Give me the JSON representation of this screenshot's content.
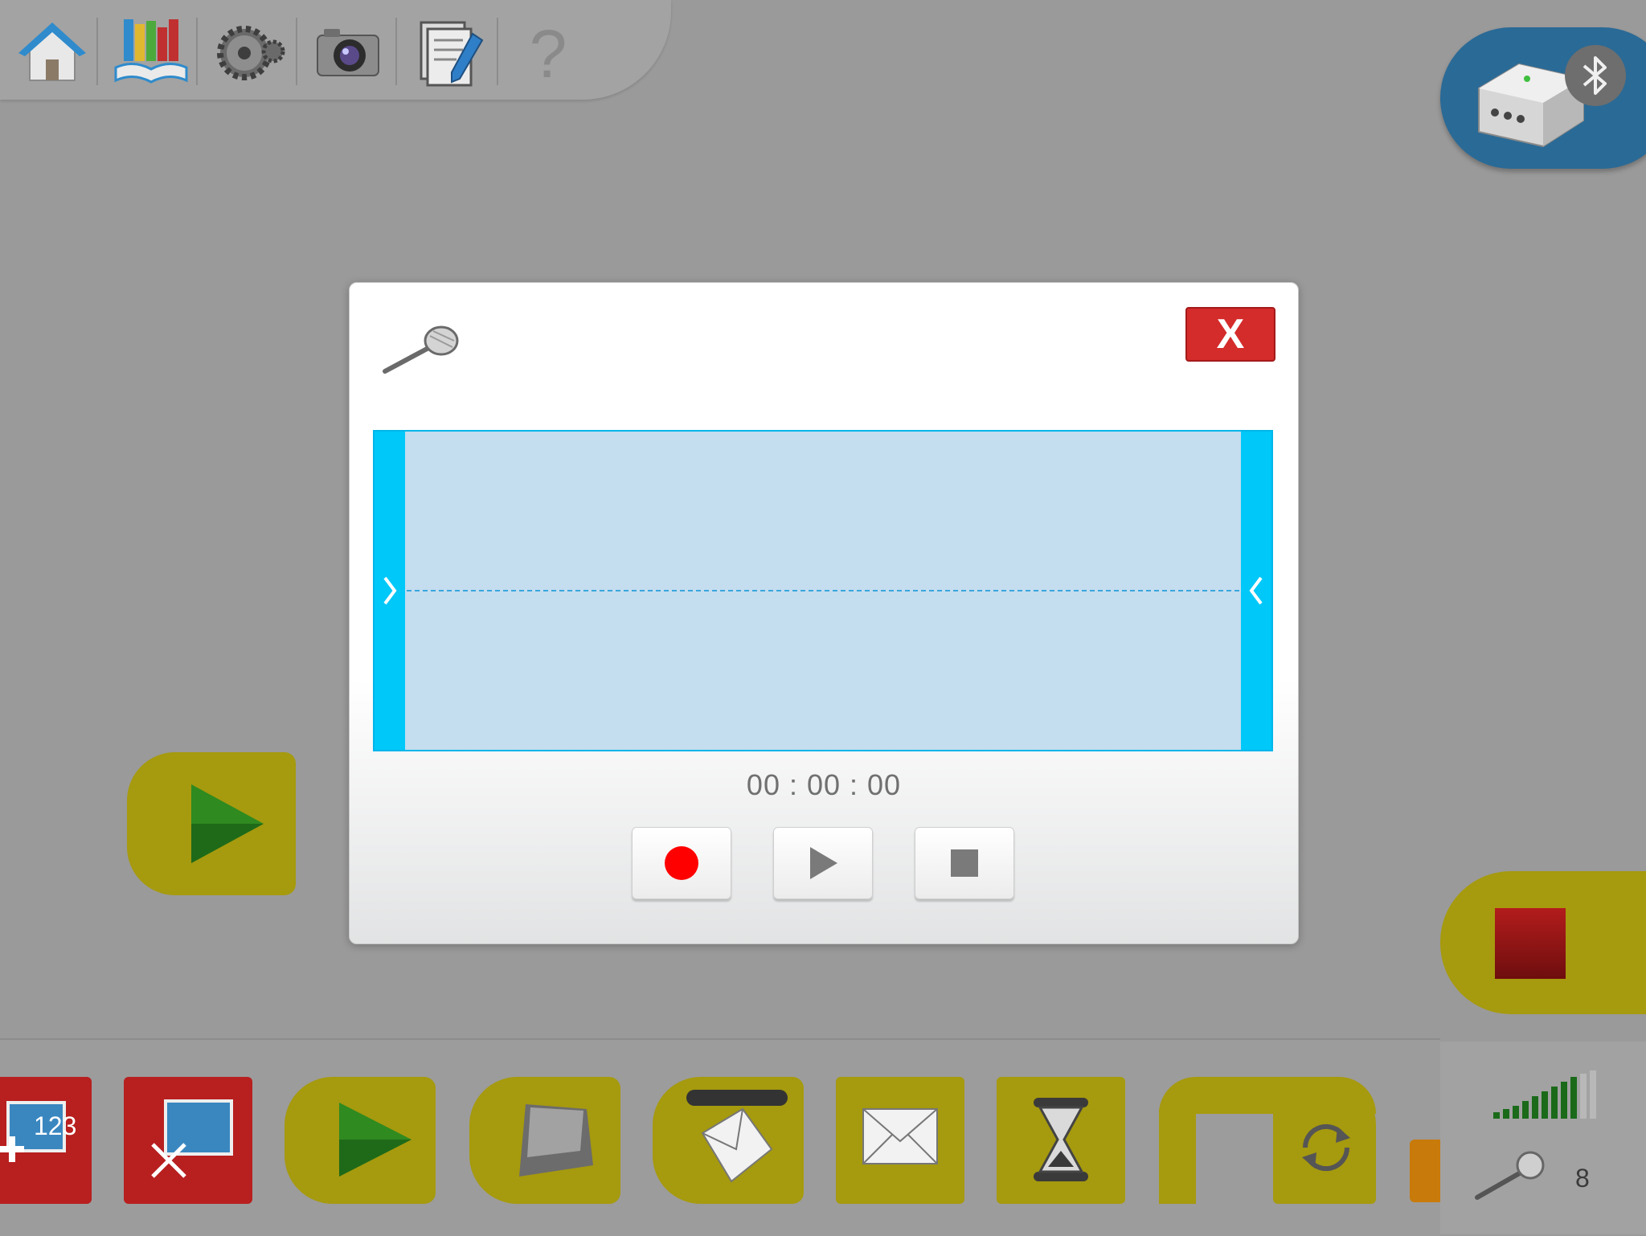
{
  "toolbar": {
    "icons": [
      "home-icon",
      "library-icon",
      "settings-icon",
      "camera-icon",
      "document-icon",
      "help-icon"
    ]
  },
  "hub": {
    "icons": [
      "smarthub-icon",
      "bluetooth-icon"
    ]
  },
  "recorder": {
    "icon": "microphone-icon",
    "close_label": "X",
    "timer": "00 : 00 : 00",
    "buttons": [
      "record-button",
      "play-button",
      "stop-button"
    ],
    "colors": {
      "record": "#ff0000",
      "wave_bg": "#c4ddef",
      "handle": "#00c8f8",
      "close": "#d42b2b"
    }
  },
  "palette": {
    "blocks": [
      "display-number-block",
      "display-shrink-block",
      "start-block",
      "key-press-block",
      "receive-message-block",
      "send-message-block",
      "wait-block",
      "repeat-block"
    ]
  },
  "status": {
    "count": "8",
    "icons": [
      "signal-strength-icon",
      "microphone-icon"
    ]
  }
}
